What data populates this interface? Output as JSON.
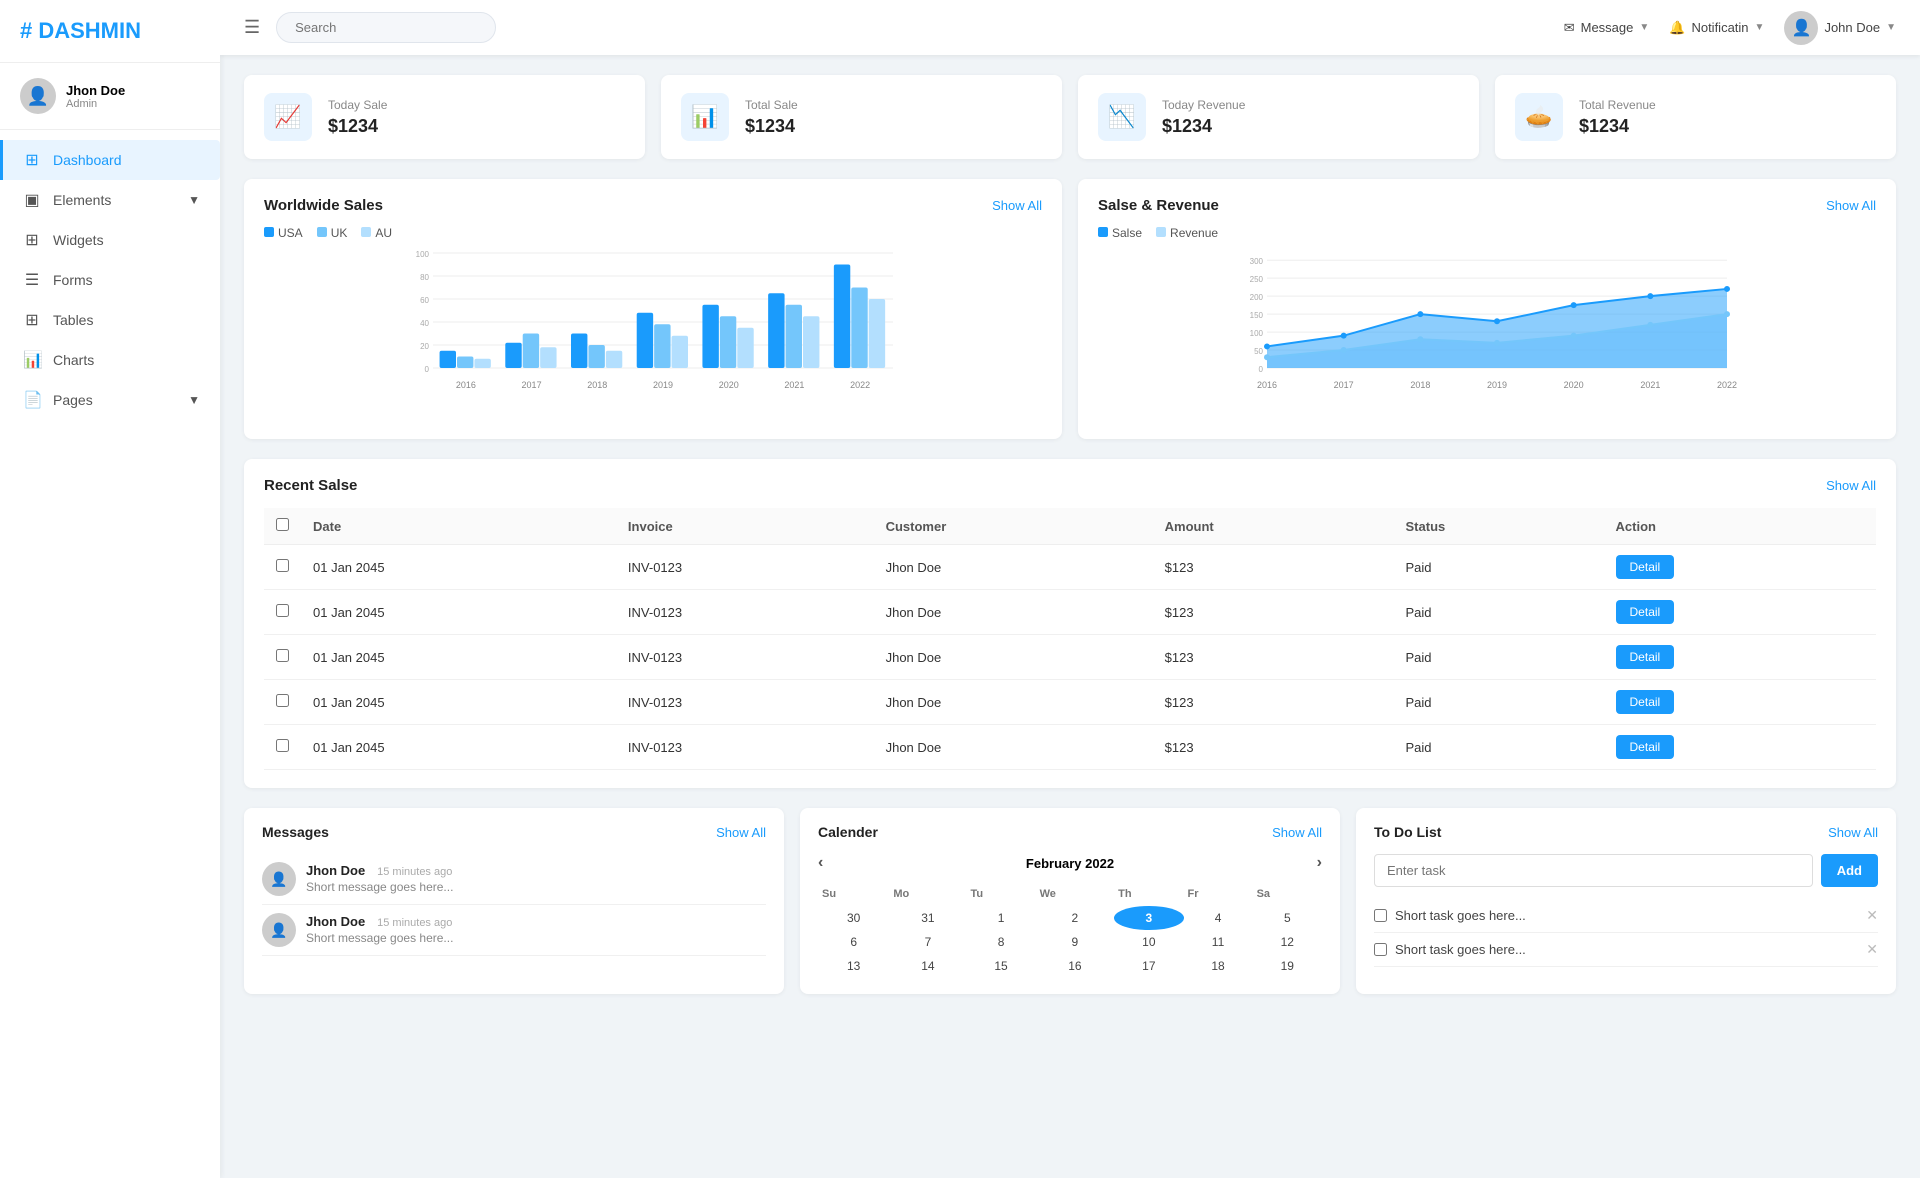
{
  "brand": {
    "logo": "# DASHMIN"
  },
  "sidebar": {
    "user": {
      "name": "Jhon Doe",
      "role": "Admin",
      "avatar_emoji": "👤"
    },
    "items": [
      {
        "id": "dashboard",
        "label": "Dashboard",
        "icon": "⊞",
        "active": true,
        "has_arrow": false
      },
      {
        "id": "elements",
        "label": "Elements",
        "icon": "▣",
        "active": false,
        "has_arrow": true
      },
      {
        "id": "widgets",
        "label": "Widgets",
        "icon": "⊞",
        "active": false,
        "has_arrow": false
      },
      {
        "id": "forms",
        "label": "Forms",
        "icon": "☰",
        "active": false,
        "has_arrow": false
      },
      {
        "id": "tables",
        "label": "Tables",
        "icon": "⊞",
        "active": false,
        "has_arrow": false
      },
      {
        "id": "charts",
        "label": "Charts",
        "icon": "📊",
        "active": false,
        "has_arrow": false
      },
      {
        "id": "pages",
        "label": "Pages",
        "icon": "📄",
        "active": false,
        "has_arrow": true
      }
    ]
  },
  "header": {
    "search_placeholder": "Search",
    "message_label": "Message",
    "notification_label": "Notificatin",
    "user_label": "John Doe",
    "user_avatar_emoji": "👤"
  },
  "stat_cards": [
    {
      "label": "Today Sale",
      "value": "$1234",
      "icon": "📈"
    },
    {
      "label": "Total Sale",
      "value": "$1234",
      "icon": "📊"
    },
    {
      "label": "Today Revenue",
      "value": "$1234",
      "icon": "📉"
    },
    {
      "label": "Total Revenue",
      "value": "$1234",
      "icon": "🥧"
    }
  ],
  "worldwide_sales": {
    "title": "Worldwide Sales",
    "show_all": "Show All",
    "legend": [
      {
        "label": "USA",
        "color": "#1a9bfc"
      },
      {
        "label": "UK",
        "color": "#74c6fb"
      },
      {
        "label": "AU",
        "color": "#b3dffe"
      }
    ],
    "years": [
      "2016",
      "2017",
      "2018",
      "2019",
      "2020",
      "2021",
      "2022"
    ],
    "usa": [
      15,
      22,
      30,
      48,
      55,
      65,
      90
    ],
    "uk": [
      10,
      30,
      20,
      38,
      45,
      55,
      70
    ],
    "au": [
      8,
      18,
      15,
      28,
      35,
      45,
      60
    ]
  },
  "sales_revenue": {
    "title": "Salse & Revenue",
    "show_all": "Show All",
    "legend": [
      {
        "label": "Salse",
        "color": "#1a9bfc"
      },
      {
        "label": "Revenue",
        "color": "#b3dffe"
      }
    ],
    "years": [
      "2016",
      "2017",
      "2018",
      "2019",
      "2020",
      "2021",
      "2022"
    ],
    "sales": [
      60,
      90,
      150,
      130,
      175,
      200,
      220
    ],
    "revenue": [
      30,
      50,
      80,
      70,
      90,
      120,
      150
    ]
  },
  "recent_sales": {
    "title": "Recent Salse",
    "show_all": "Show All",
    "columns": [
      "",
      "Date",
      "Invoice",
      "Customer",
      "Amount",
      "Status",
      "Action"
    ],
    "rows": [
      {
        "date": "01 Jan 2045",
        "invoice": "INV-0123",
        "customer": "Jhon Doe",
        "amount": "$123",
        "status": "Paid"
      },
      {
        "date": "01 Jan 2045",
        "invoice": "INV-0123",
        "customer": "Jhon Doe",
        "amount": "$123",
        "status": "Paid"
      },
      {
        "date": "01 Jan 2045",
        "invoice": "INV-0123",
        "customer": "Jhon Doe",
        "amount": "$123",
        "status": "Paid"
      },
      {
        "date": "01 Jan 2045",
        "invoice": "INV-0123",
        "customer": "Jhon Doe",
        "amount": "$123",
        "status": "Paid"
      },
      {
        "date": "01 Jan 2045",
        "invoice": "INV-0123",
        "customer": "Jhon Doe",
        "amount": "$123",
        "status": "Paid"
      }
    ],
    "action_label": "Detail"
  },
  "messages": {
    "title": "Messages",
    "show_all": "Show All",
    "items": [
      {
        "name": "Jhon Doe",
        "time": "15 minutes ago",
        "text": "Short message goes here...",
        "avatar": "👤"
      },
      {
        "name": "Jhon Doe",
        "time": "15 minutes ago",
        "text": "Short message goes here...",
        "avatar": "👤"
      }
    ]
  },
  "calendar": {
    "title": "Calender",
    "show_all": "Show All",
    "month_year": "February 2022",
    "day_headers": [
      "Su",
      "Mo",
      "Tu",
      "We",
      "Th",
      "Fr",
      "Sa"
    ],
    "weeks": [
      [
        "30",
        "31",
        "1",
        "2",
        "3",
        "4",
        "5"
      ],
      [
        "6",
        "7",
        "8",
        "9",
        "10",
        "11",
        "12"
      ],
      [
        "13",
        "14",
        "15",
        "16",
        "17",
        "18",
        "19"
      ]
    ],
    "today": "3"
  },
  "todo": {
    "title": "To Do List",
    "show_all": "Show All",
    "input_placeholder": "Enter task",
    "add_button": "Add",
    "items": [
      {
        "text": "Short task goes here..."
      },
      {
        "text": "Short task goes here..."
      }
    ]
  }
}
